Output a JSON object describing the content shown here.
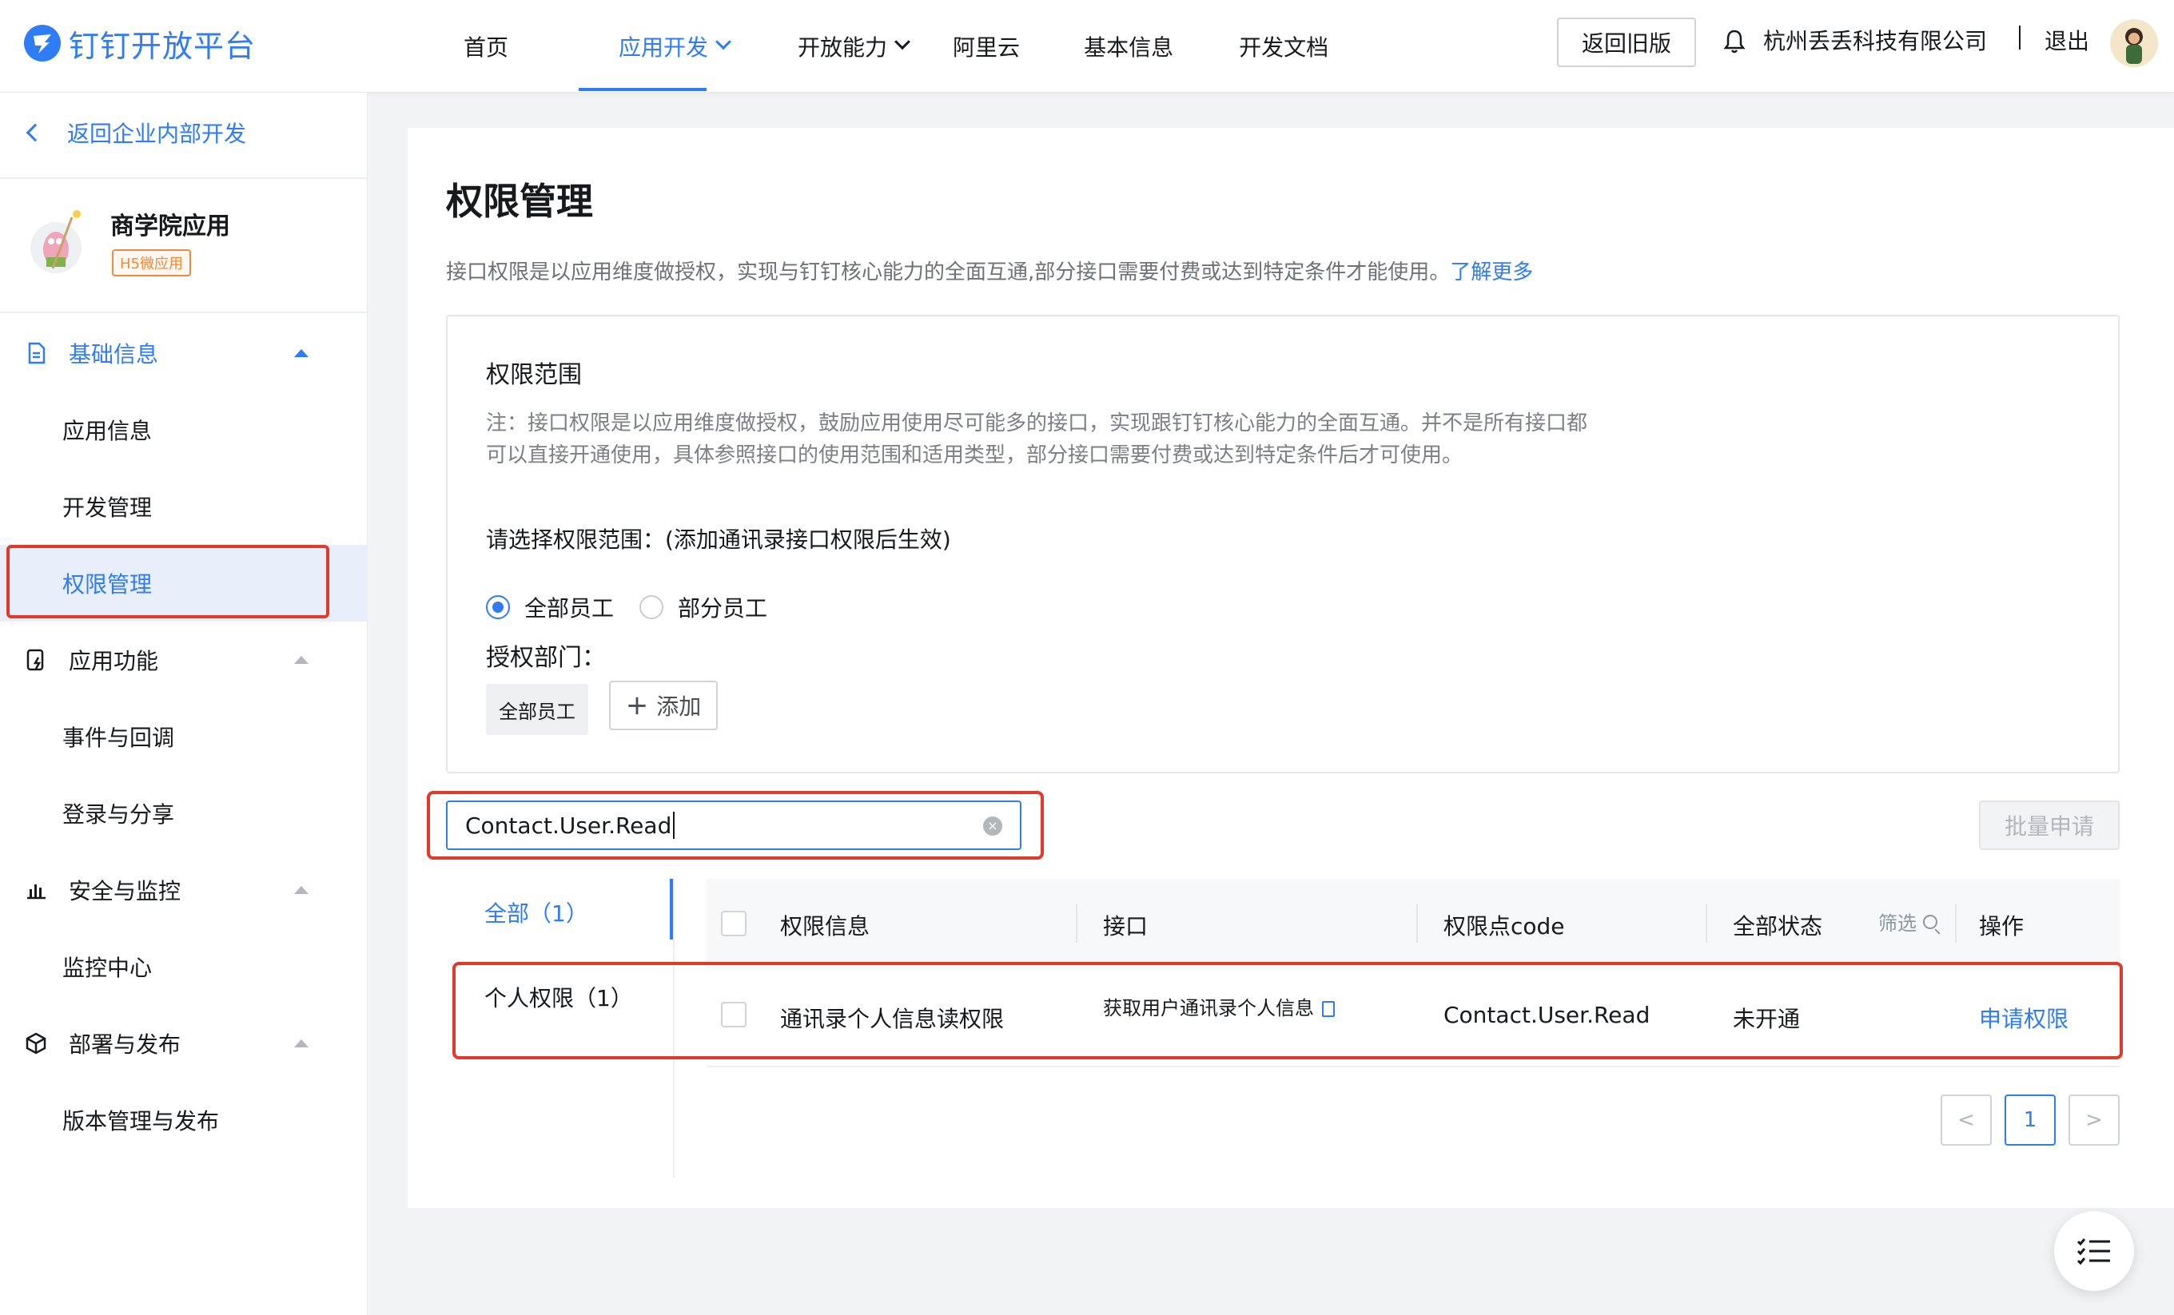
{
  "header": {
    "logo_text": "钉钉开放平台",
    "nav": [
      {
        "label": "首页"
      },
      {
        "label": "应用开发"
      },
      {
        "label": "开放能力"
      },
      {
        "label": "阿里云"
      },
      {
        "label": "基本信息"
      },
      {
        "label": "开发文档"
      }
    ],
    "back_old": "返回旧版",
    "company": "杭州丢丢科技有限公司",
    "logout": "退出"
  },
  "sidebar": {
    "back": "返回企业内部开发",
    "app_name": "商学院应用",
    "app_tag": "H5微应用",
    "groups": [
      {
        "label": "基础信息",
        "items": [
          "应用信息",
          "开发管理",
          "权限管理"
        ]
      },
      {
        "label": "应用功能",
        "items": [
          "事件与回调",
          "登录与分享"
        ]
      },
      {
        "label": "安全与监控",
        "items": [
          "监控中心"
        ]
      },
      {
        "label": "部署与发布",
        "items": [
          "版本管理与发布"
        ]
      }
    ]
  },
  "main": {
    "title": "权限管理",
    "desc": "接口权限是以应用维度做授权，实现与钉钉核心能力的全面互通,部分接口需要付费或达到特定条件才能使用。",
    "learn_more": "了解更多",
    "scope": {
      "title": "权限范围",
      "note": "注：接口权限是以应用维度做授权，鼓励应用使用尽可能多的接口，实现跟钉钉核心能力的全面互通。并不是所有接口都可以直接开通使用，具体参照接口的使用范围和适用类型，部分接口需要付费或达到特定条件后才可使用。",
      "choose": "请选择权限范围：(添加通讯录接口权限后生效)",
      "radio_all": "全部员工",
      "radio_part": "部分员工",
      "dept_label": "授权部门：",
      "dept_tag": "全部员工",
      "add": "添加"
    },
    "search": {
      "value": "Contact.User.Read"
    },
    "batch_apply": "批量申请",
    "tabs": {
      "all": "全部（1）",
      "personal": "个人权限（1）"
    },
    "table": {
      "headers": [
        "权限信息",
        "接口",
        "权限点code",
        "全部状态",
        "操作"
      ],
      "filter": "筛选",
      "rows": [
        {
          "info": "通讯录个人信息读权限",
          "api": "获取用户通讯录个人信息",
          "code": "Contact.User.Read",
          "status": "未开通",
          "action": "申请权限"
        }
      ]
    },
    "pagination": {
      "prev": "<",
      "current": "1",
      "next": ">"
    }
  },
  "colors": {
    "primary": "#2f7cf6",
    "highlight": "#e03a2a"
  }
}
